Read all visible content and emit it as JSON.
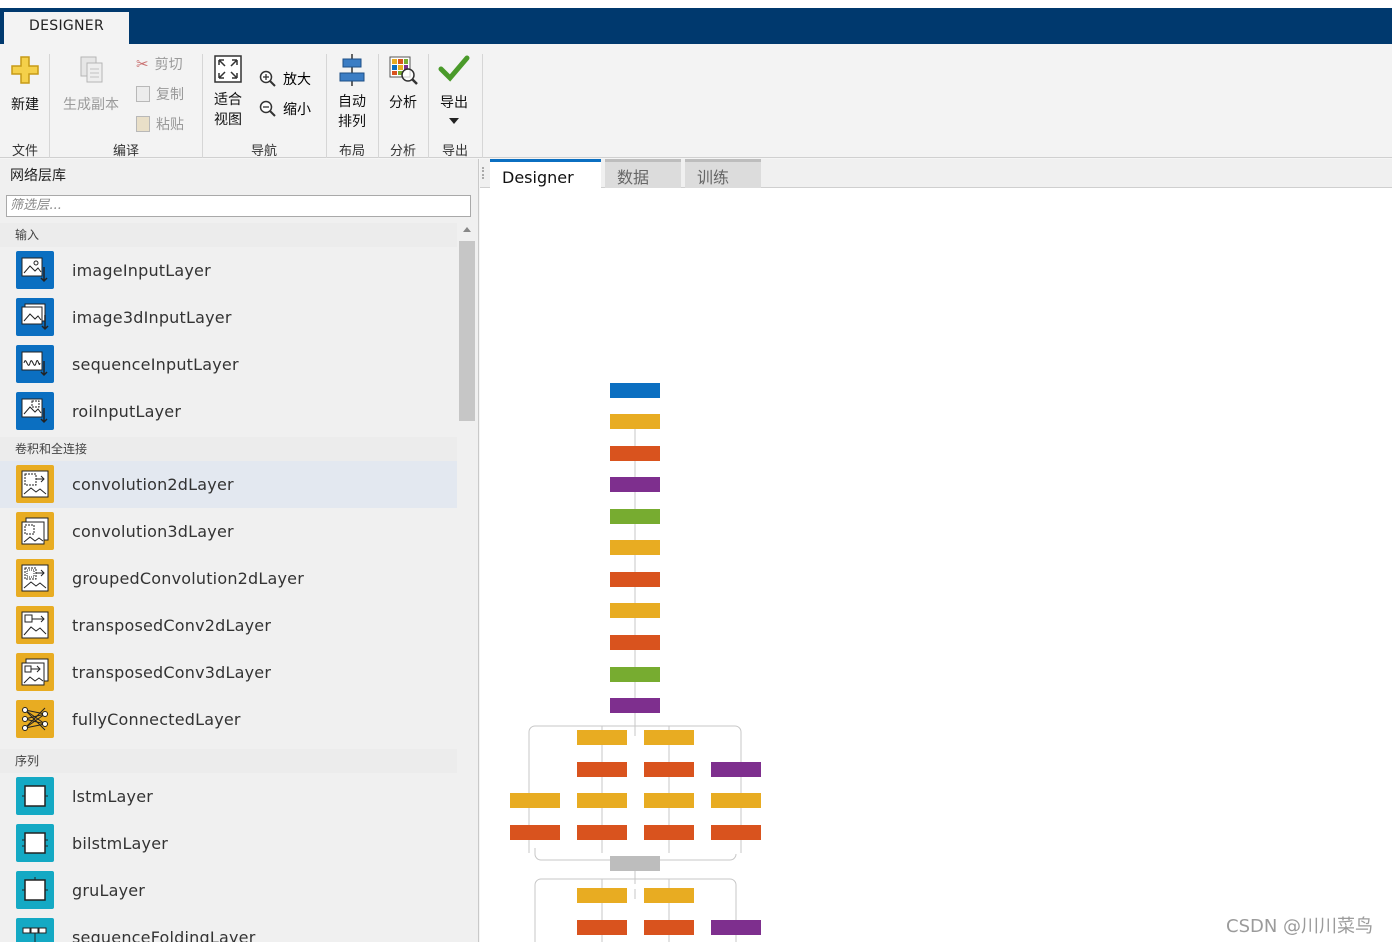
{
  "app": {
    "tab": "DESIGNER"
  },
  "toolstrip": {
    "new_label": "新建",
    "duplicate_label": "生成副本",
    "cut_label": "剪切",
    "copy_label": "复制",
    "paste_label": "粘贴",
    "fit_label_1": "适合",
    "fit_label_2": "视图",
    "zoom_in_label": "放大",
    "zoom_out_label": "缩小",
    "auto_arrange_1": "自动",
    "auto_arrange_2": "排列",
    "analyze_label": "分析",
    "export_label": "导出",
    "groups": {
      "file": "文件",
      "compile": "编译",
      "navigate": "导航",
      "layout": "布局",
      "analyze": "分析",
      "export": "导出"
    }
  },
  "library": {
    "title": "网络层库",
    "filter_placeholder": "筛选层...",
    "categories": {
      "input": "输入",
      "conv": "卷积和全连接",
      "sequence": "序列"
    },
    "input_layers": [
      "imageInputLayer",
      "image3dInputLayer",
      "sequenceInputLayer",
      "roiInputLayer"
    ],
    "conv_layers": [
      "convolution2dLayer",
      "convolution3dLayer",
      "groupedConvolution2dLayer",
      "transposedConv2dLayer",
      "transposedConv3dLayer",
      "fullyConnectedLayer"
    ],
    "sequence_layers": [
      "lstmLayer",
      "bilstmLayer",
      "gruLayer",
      "sequenceFoldingLayer"
    ]
  },
  "tabs": {
    "designer": "Designer",
    "data": "数据",
    "train": "训练"
  },
  "colors": {
    "input": "#0b6fc1",
    "yellow": "#e8ac22",
    "orange": "#d9531e",
    "purple": "#7e2f8e",
    "green": "#77ac30",
    "gray": "#bdbdbd"
  },
  "watermark": "CSDN @川川菜鸟"
}
